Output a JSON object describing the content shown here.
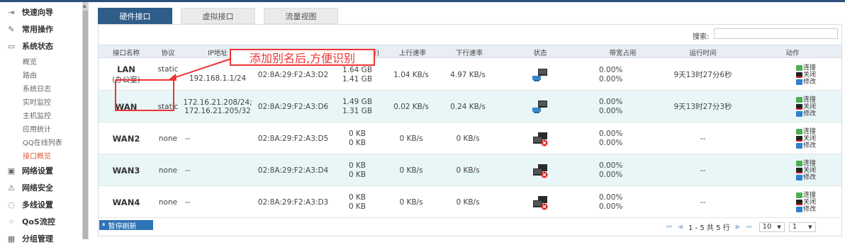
{
  "sidebar": {
    "groups_top": [
      {
        "icon": "⇥",
        "label": "快速向导"
      },
      {
        "icon": "✎",
        "label": "常用操作"
      },
      {
        "icon": "▭",
        "label": "系统状态"
      }
    ],
    "sub_items": [
      "概览",
      "路由",
      "系统日志",
      "实时监控",
      "主机监控",
      "应用统计",
      "QQ在线列表",
      "接口概览"
    ],
    "active_sub": "接口概览",
    "groups_bottom": [
      {
        "icon": "▣",
        "label": "网络设置"
      },
      {
        "icon": "⚠",
        "label": "网络安全"
      },
      {
        "icon": "◌",
        "label": "多线设置"
      },
      {
        "icon": "⁘",
        "label": "QoS流控"
      },
      {
        "icon": "▦",
        "label": "分组管理"
      }
    ]
  },
  "tabs": [
    "硬件接口",
    "虚拟接口",
    "流量视图"
  ],
  "search": {
    "label": "搜索:",
    "value": ""
  },
  "annotation": "添加别名后,方便识别",
  "columns": [
    "接口名称",
    "协议",
    "IP地址",
    "MAC地址",
    "流量(上/下行)",
    "上行速率",
    "下行速率",
    "状态",
    "带宽占用",
    "运行时间",
    "动作"
  ],
  "rows": [
    {
      "name": "LAN",
      "alias": "(办公室)",
      "proto": "static",
      "ip1": "192.168.1.1/24",
      "ip2": "",
      "mac": "02:8A:29:F2:A3:D2",
      "up_traffic": "1.64 GB",
      "down_traffic": "1.41 GB",
      "up_rate": "1.04 KB/s",
      "down_rate": "4.97 KB/s",
      "connected": true,
      "bw_up": "0.00%",
      "bw_down": "0.00%",
      "uptime": "9天13时27分6秒"
    },
    {
      "name": "WAN",
      "alias": "",
      "proto": "static",
      "ip1": "172.16.21.208/24;",
      "ip2": "172.16.21.205/32",
      "mac": "02:8A:29:F2:A3:D6",
      "up_traffic": "1.49 GB",
      "down_traffic": "1.31 GB",
      "up_rate": "0.02 KB/s",
      "down_rate": "0.24 KB/s",
      "connected": true,
      "bw_up": "0.00%",
      "bw_down": "0.00%",
      "uptime": "9天13时27分3秒"
    },
    {
      "name": "WAN2",
      "alias": "",
      "proto": "none",
      "ip1": "--",
      "ip2": "",
      "mac": "02:8A:29:F2:A3:D5",
      "up_traffic": "0 KB",
      "down_traffic": "0 KB",
      "up_rate": "0 KB/s",
      "down_rate": "0 KB/s",
      "connected": false,
      "bw_up": "0.00%",
      "bw_down": "0.00%",
      "uptime": "--"
    },
    {
      "name": "WAN3",
      "alias": "",
      "proto": "none",
      "ip1": "--",
      "ip2": "",
      "mac": "02:8A:29:F2:A3:D4",
      "up_traffic": "0 KB",
      "down_traffic": "0 KB",
      "up_rate": "0 KB/s",
      "down_rate": "0 KB/s",
      "connected": false,
      "bw_up": "0.00%",
      "bw_down": "0.00%",
      "uptime": "--"
    },
    {
      "name": "WAN4",
      "alias": "",
      "proto": "none",
      "ip1": "--",
      "ip2": "",
      "mac": "02:8A:29:F2:A3:D3",
      "up_traffic": "0 KB",
      "down_traffic": "0 KB",
      "up_rate": "0 KB/s",
      "down_rate": "0 KB/s",
      "connected": false,
      "bw_up": "0.00%",
      "bw_down": "0.00%",
      "uptime": "--"
    }
  ],
  "actions": [
    "连接",
    "关闭",
    "修改"
  ],
  "footer": {
    "pause_label": "暂停刷新",
    "pager_text": "1 - 5 共 5 行",
    "page_size": "10",
    "page": "1"
  },
  "colors": {
    "accent": "#2f5d8a",
    "annotation": "#e33333",
    "active_menu": "#e25b3a"
  }
}
